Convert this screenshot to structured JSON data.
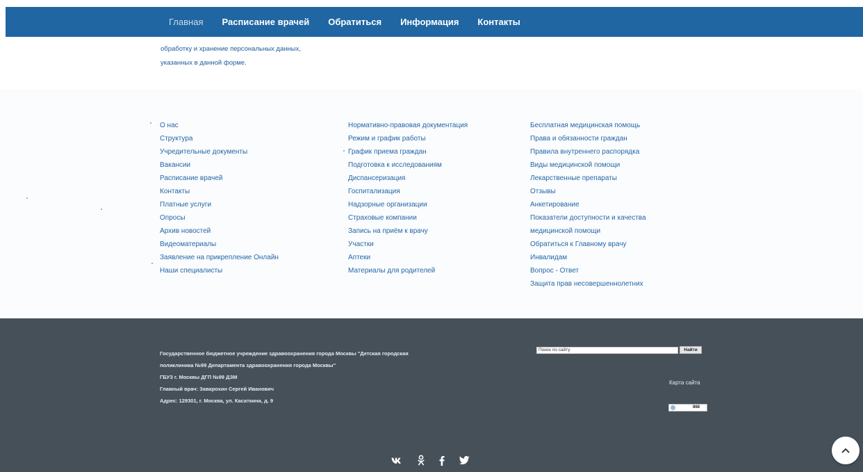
{
  "nav": {
    "items": [
      {
        "label": "Главная"
      },
      {
        "label": "Расписание врачей"
      },
      {
        "label": "Обратиться"
      },
      {
        "label": "Информация"
      },
      {
        "label": "Контакты"
      }
    ]
  },
  "consent": {
    "line1": "обработку и хранение персональных данных,",
    "line2": "указанных в данной форме."
  },
  "links": {
    "col1": [
      "О нас",
      "Структура",
      "Учредительные документы",
      "Вакансии",
      "Расписание врачей",
      "Контакты",
      "Платные услуги",
      "Опросы",
      "Архив новостей",
      "Видеоматериалы",
      "Заявление на прикрепление Онлайн",
      "Наши специалисты"
    ],
    "col2": [
      "Нормативно-правовая документация",
      "Режим и график работы",
      "График приема граждан",
      "Подготовка к исследованиям",
      "Диспансеризация",
      "Госпитализация",
      "Надзорные организации",
      "Страховые компании",
      "Запись на приём к врачу",
      "Участки",
      "Аптеки",
      "Материалы для родителей"
    ],
    "col3": [
      "Бесплатная медицинская помощь",
      "Права и обязанности граждан",
      "Правила внутреннего распорядка",
      "Виды медицинской помощи",
      "Лекарственные препараты",
      "Отзывы",
      "Анкетирование",
      "Показатели доступности и качества",
      "медицинской помощи",
      "Обратиться к Главному врачу",
      "Инвалидам",
      "Вопрос - Ответ",
      "Защита прав несовершеннолетних"
    ]
  },
  "footer": {
    "org_line1": "Государственное бюджетное учреждение здравоохранения города Москвы \"Детская городская",
    "org_line2": "поликлиника №99 Департамента здравоохранения города Москвы\"",
    "org_line3": "ГБУЗ г. Москвы ДГП №99 ДЗМ",
    "org_line4": "Главный врач: Заварохин Сергей Иванович",
    "org_line5": "Адрес: 129301, г. Москва, ул. Касаткина, д. 9",
    "search_value": "Поиск по сайту",
    "search_button": "Найти",
    "sitemap": "Карта сайта",
    "counter_value": "868"
  },
  "social": {
    "vk": "вк",
    "ok": "ок",
    "fb": "f",
    "tw": "tw"
  },
  "icons": {
    "vk": "vk-icon",
    "ok": "odnoklassniki-icon",
    "fb": "facebook-icon",
    "tw": "twitter-icon",
    "to_top": "chevron-up-icon"
  },
  "colors": {
    "nav_bg": "#1f66a2",
    "link": "#2466a8",
    "footer_bg": "#465059"
  }
}
